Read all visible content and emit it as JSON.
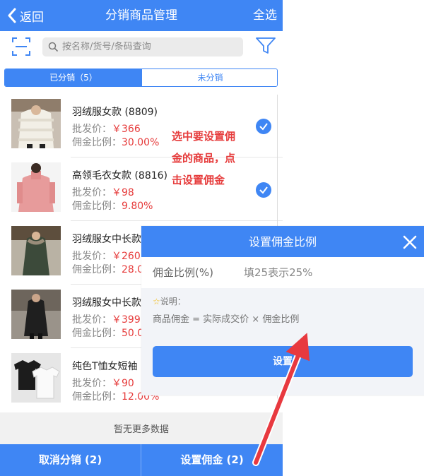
{
  "header": {
    "back_label": "返回",
    "title": "分销商品管理",
    "select_all": "全选"
  },
  "search": {
    "placeholder": "按名称/货号/条码查询",
    "value": ""
  },
  "tabs": [
    {
      "label": "已分销（5）",
      "active": true
    },
    {
      "label": "未分销",
      "active": false
    }
  ],
  "labels": {
    "wholesale": "批发价：",
    "commission": "佣金比例："
  },
  "items": [
    {
      "name": "羽绒服女款 (8809)",
      "price": "￥366",
      "rate": "30.00%",
      "checked": true
    },
    {
      "name": "高领毛衣女款 (8816)",
      "price": "￥98",
      "rate": "9.80%",
      "checked": true
    },
    {
      "name": "羽绒服女中长款",
      "price": "￥260",
      "rate": "28.0",
      "checked": false
    },
    {
      "name": "羽绒服女中长款",
      "price": "￥399",
      "rate": "50.0",
      "checked": false
    },
    {
      "name": "纯色T恤女短袖 (",
      "price": "￥90",
      "rate": "12.00%",
      "checked": false
    }
  ],
  "no_more": "暂无更多数据",
  "footer": {
    "cancel": "取消分销 (2)",
    "set": "设置佣金 (2)"
  },
  "annotation": [
    "选中要设置佣",
    "金的商品，点",
    "击设置佣金"
  ],
  "modal": {
    "title": "设置佣金比例",
    "field_label": "佣金比例(%)",
    "field_placeholder": "填25表示25%",
    "note_star": "☆",
    "note_title": "说明：",
    "note_text": "商品佣金 = 实际成交价 × 佣金比例",
    "button": "设置"
  },
  "colors": {
    "primary": "#3f86f4",
    "price_red": "#e63b3b",
    "arrow_red": "#e8393f",
    "note_bg": "#f2f4f8"
  },
  "icons": [
    "back-chevron-icon",
    "scan-icon",
    "search-icon",
    "filter-icon",
    "checkmark-icon",
    "close-icon",
    "star-icon"
  ]
}
